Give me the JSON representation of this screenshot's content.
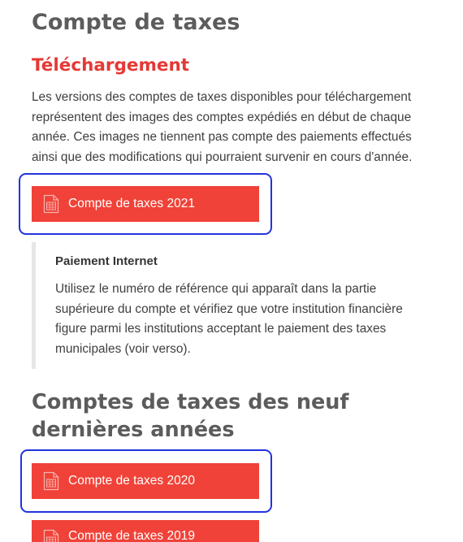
{
  "page": {
    "title": "Compte de taxes",
    "download_heading": "Téléchargement",
    "intro_text": "Les versions des comptes de taxes disponibles pour téléchargement représentent des images des comptes expédiés en début de chaque année. Ces images ne tiennent pas compte des paiements effectués ainsi que des modifications qui pourraient survenir en cours d'année.",
    "previous_years_heading": "Comptes de taxes des neuf dernières années"
  },
  "downloads": {
    "current": {
      "label": "Compte de taxes 2021",
      "icon": "document-icon"
    },
    "previous": [
      {
        "label": "Compte de taxes 2020",
        "icon": "document-icon"
      },
      {
        "label": "Compte de taxes 2019",
        "icon": "document-icon"
      }
    ]
  },
  "payment_note": {
    "title": "Paiement Internet",
    "body": "Utilisez le numéro de référence qui apparaît dans la partie supérieure du compte et vérifiez que votre institution financière figure parmi les institutions acceptant le paiement des taxes municipales (voir verso)."
  },
  "colors": {
    "accent_red": "#f04238",
    "heading_red": "#e53935",
    "heading_gray": "#5c5c5c",
    "focus_ring_blue": "#2233dd",
    "note_border": "#e6e6e6"
  }
}
